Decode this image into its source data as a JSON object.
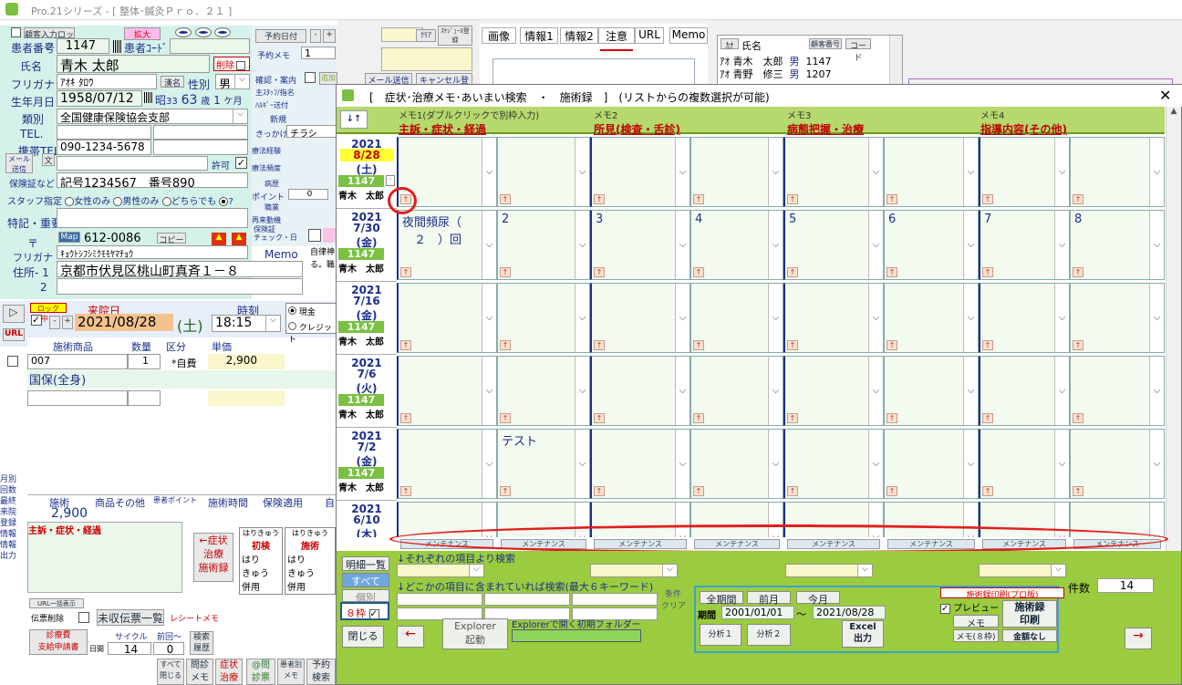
{
  "app": {
    "title": "Pro.21シリーズ - [ 整体･鍼灸Ｐｒｏ．２１ ]"
  },
  "patient": {
    "chk_label": "顧客入力ロック",
    "zoom_btn": "拡大",
    "number_label": "患者番号",
    "number": "1147",
    "code_btn": "患者ｺｰﾄﾞ",
    "name_label": "氏名",
    "name": "青木 太郎",
    "delete_label": "削除",
    "kana_label": "フリガナ",
    "kana": "ｱｵｷ ﾀﾛｳ",
    "kana_btn": "漢名",
    "gender_label": "性別",
    "gender": "男",
    "dob_label": "生年月日",
    "dob": "1958/07/12",
    "era": "昭",
    "era_year": "33",
    "age": "63",
    "age_unit": "歳",
    "months": "1",
    "month_unit": "ケ月",
    "type_label": "類別",
    "insurer": "全国健康保険協会支部",
    "tel_label": "TEL.",
    "mobile_label": "携帯TEL",
    "mobile": "090-1234-5678",
    "mail_btn": "メール送信",
    "doc_btn": "文",
    "permit_label": "許可",
    "insurance_label": "保険証など",
    "insurance": "記号1234567　番号890",
    "staff_label": "スタッフ指定",
    "staff_opt1": "女性のみ",
    "staff_opt2": "男性のみ",
    "staff_opt3": "どちらでも",
    "staff_q": "?",
    "notes_label": "特記・重要",
    "zip_label": "〒",
    "map_btn": "Map",
    "zip": "612-0086",
    "copy_btn": "コピー",
    "addr_kana_label": "フリガナ",
    "addr_kana": "ｷｮｳﾄｼﾌｼﾐｸﾓﾓﾔﾏﾁｮｳ",
    "addr1_label": "住所- 1",
    "addr1": "京都市伏見区桃山町真斉１－８",
    "addr2_label": "2",
    "memo_label": "Memo",
    "memo_text": "自律神\nる。職"
  },
  "middle": {
    "appt_btn": "予約日付",
    "clear_btn": "ｸﾘｱ",
    "schedule_btn": "ｽｹｼﾞｭｰﾙ登録",
    "appt_memo_label": "予約メモ",
    "appt_memo_val": "1",
    "confirm_label": "確認・案内",
    "add_appt_btn": "追加予約",
    "mail_send_btn": "メール送信",
    "cancel_btn": "キャンセル登",
    "staff_label": "主ｽﾀｯﾌ/指名",
    "haru_label": "ﾊﾙｷﾞｰ送付",
    "new_label": "新規",
    "trigger_label": "きっかけ",
    "trigger_val": "チラシ",
    "history1": "療法経験",
    "history2": "療法頻度",
    "disease": "病歴",
    "point_label": "ポイント",
    "point_val": "0",
    "job_label": "職業",
    "visit_label": "再来動機",
    "ins_check": "保険証\nチェック・日"
  },
  "visit": {
    "lock_label": "ロック中！",
    "date_label": "来院日",
    "date": "2021/08/28",
    "weekday": "(土)",
    "time_label": "時刻",
    "time": "18:15",
    "pay1": "現金",
    "pay2": "クレジット",
    "url_btn": "URL",
    "col_product": "施術商品",
    "col_qty": "数量",
    "col_div": "区分",
    "col_price": "単価",
    "row1_code": "007",
    "row1_qty": "1",
    "row1_div": "*自費",
    "row1_price": "2,900",
    "row2_name": "国保(全身)",
    "side_items": [
      "月別",
      "回数",
      "最終",
      "来院",
      "登録",
      "情報",
      "情報",
      "出力"
    ],
    "sum_cols": [
      "施術",
      "商品その他",
      "患者ポイント",
      "施術時間",
      "保険適用",
      "自"
    ],
    "sum_val": "2,900",
    "memo_head": "主訴・症状・経過",
    "btn_symptom": "←症状\n治療\n施術録",
    "hari1": "はりきゅう",
    "first": "初検",
    "hari_opts": [
      "はり",
      "きゅう",
      "併用"
    ],
    "hari2": "はりきゅう",
    "treat": "施術",
    "url_list": "URL一括表示",
    "slip_del": "伝票削除",
    "slip_list": "未収伝票一覧",
    "receipt": "レシートメモ",
    "med_btn": "診療費\n支給申請書",
    "cycle_label": "サイクル",
    "prev_label": "前回～",
    "cycle_val": "14",
    "prev_val": "0",
    "ago_label": "日間",
    "search_hist": "検索\n履歴",
    "bottom_btns": [
      "すべて\n閉じる",
      "問診\nメモ",
      "症状\n治療",
      "@問\n診票",
      "患者別\nメモ",
      "予約\n検索"
    ]
  },
  "tabs": [
    "画像",
    "情報1",
    "情報2",
    "注意",
    "URL",
    "Memo"
  ],
  "right_list": {
    "kana_btn": "ｶﾅ",
    "name_col": "氏名",
    "num_btn": "顧客番号",
    "code_btn": "コード",
    "rows": [
      {
        "kana": "ｱｵ",
        "name": "青木　太郎",
        "sex": "男",
        "num": "1147"
      },
      {
        "kana": "ｱｵ",
        "name": "青野　修三",
        "sex": "男",
        "num": "1207"
      }
    ]
  },
  "dialog": {
    "title": "[　症状･治療メモ･あいまい検索　・　施術録　]　(リストからの複数選択が可能)",
    "sort_btn": "↓↑",
    "columns": [
      {
        "memo": "メモ1(ダブルクリックで別枠入力)",
        "head": "主訴・症状・経過"
      },
      {
        "memo": "メモ2",
        "head": "所見(検査・舌診)"
      },
      {
        "memo": "メモ3",
        "head": "病態把握・治療"
      },
      {
        "memo": "メモ4",
        "head": "指導内容(その他)"
      }
    ],
    "rows": [
      {
        "year": "2021",
        "md": "8/28",
        "wd": "(土)",
        "id": "1147",
        "name": "青木　太郎",
        "texts": [
          "",
          "",
          "",
          "",
          "",
          "",
          "",
          ""
        ],
        "hl": true
      },
      {
        "year": "2021",
        "md": "7/30",
        "wd": "(金)",
        "id": "1147",
        "name": "青木　太郎",
        "texts": [
          "夜間頻尿（\n　２　）回",
          "2",
          "3",
          "4",
          "5",
          "6",
          "7",
          "8"
        ],
        "hl": false
      },
      {
        "year": "2021",
        "md": "7/16",
        "wd": "(金)",
        "id": "1147",
        "name": "青木　太郎",
        "texts": [
          "",
          "",
          "",
          "",
          "",
          "",
          "",
          ""
        ],
        "hl": false
      },
      {
        "year": "2021",
        "md": "7/6",
        "wd": "(火)",
        "id": "1147",
        "name": "青木　太郎",
        "texts": [
          "",
          "",
          "",
          "",
          "",
          "",
          "",
          ""
        ],
        "hl": false
      },
      {
        "year": "2021",
        "md": "7/2",
        "wd": "(金)",
        "id": "1147",
        "name": "青木　太郎",
        "texts": [
          "",
          "テスト",
          "",
          "",
          "",
          "",
          "",
          ""
        ],
        "hl": false
      },
      {
        "year": "2021",
        "md": "6/10",
        "wd": "(木)",
        "id": "",
        "name": "",
        "texts": [
          "",
          "",
          "",
          "",
          "",
          "",
          "",
          ""
        ],
        "hl": false
      }
    ],
    "maint_label": "メンテナンス",
    "list_btn": "明細一覧",
    "all_btn": "すべて",
    "each_btn": "個別",
    "each_search": "↓それぞれの項目より検索",
    "any_search": "↓どこかの項目に含まれていれば検索(最大６キーワード)",
    "cond_clear": "条件\nクリア",
    "eight_label": "８枠",
    "all_period": "全期間",
    "last_month": "前月",
    "this_month": "今月",
    "period_label": "期間",
    "from": "2001/01/01",
    "tilde": "～",
    "to": "2021/08/28",
    "analyze1": "分析１",
    "analyze2": "分析２",
    "excel": "Excel\n出力",
    "print_label": "施術録印刷(プロ版)",
    "preview": "プレビュー",
    "memo_btn": "メモ",
    "memo8_btn": "メモ(８枠)",
    "print_btn": "施術録\n印刷",
    "no_amount": "金額なし",
    "count_label": "件数",
    "count": "14",
    "close_btn": "閉じる",
    "prev_btn": "←",
    "next_btn": "→",
    "explorer_btn": "Explorer\n起動",
    "explorer_label": "Explorerで開く初期フォルダー"
  }
}
